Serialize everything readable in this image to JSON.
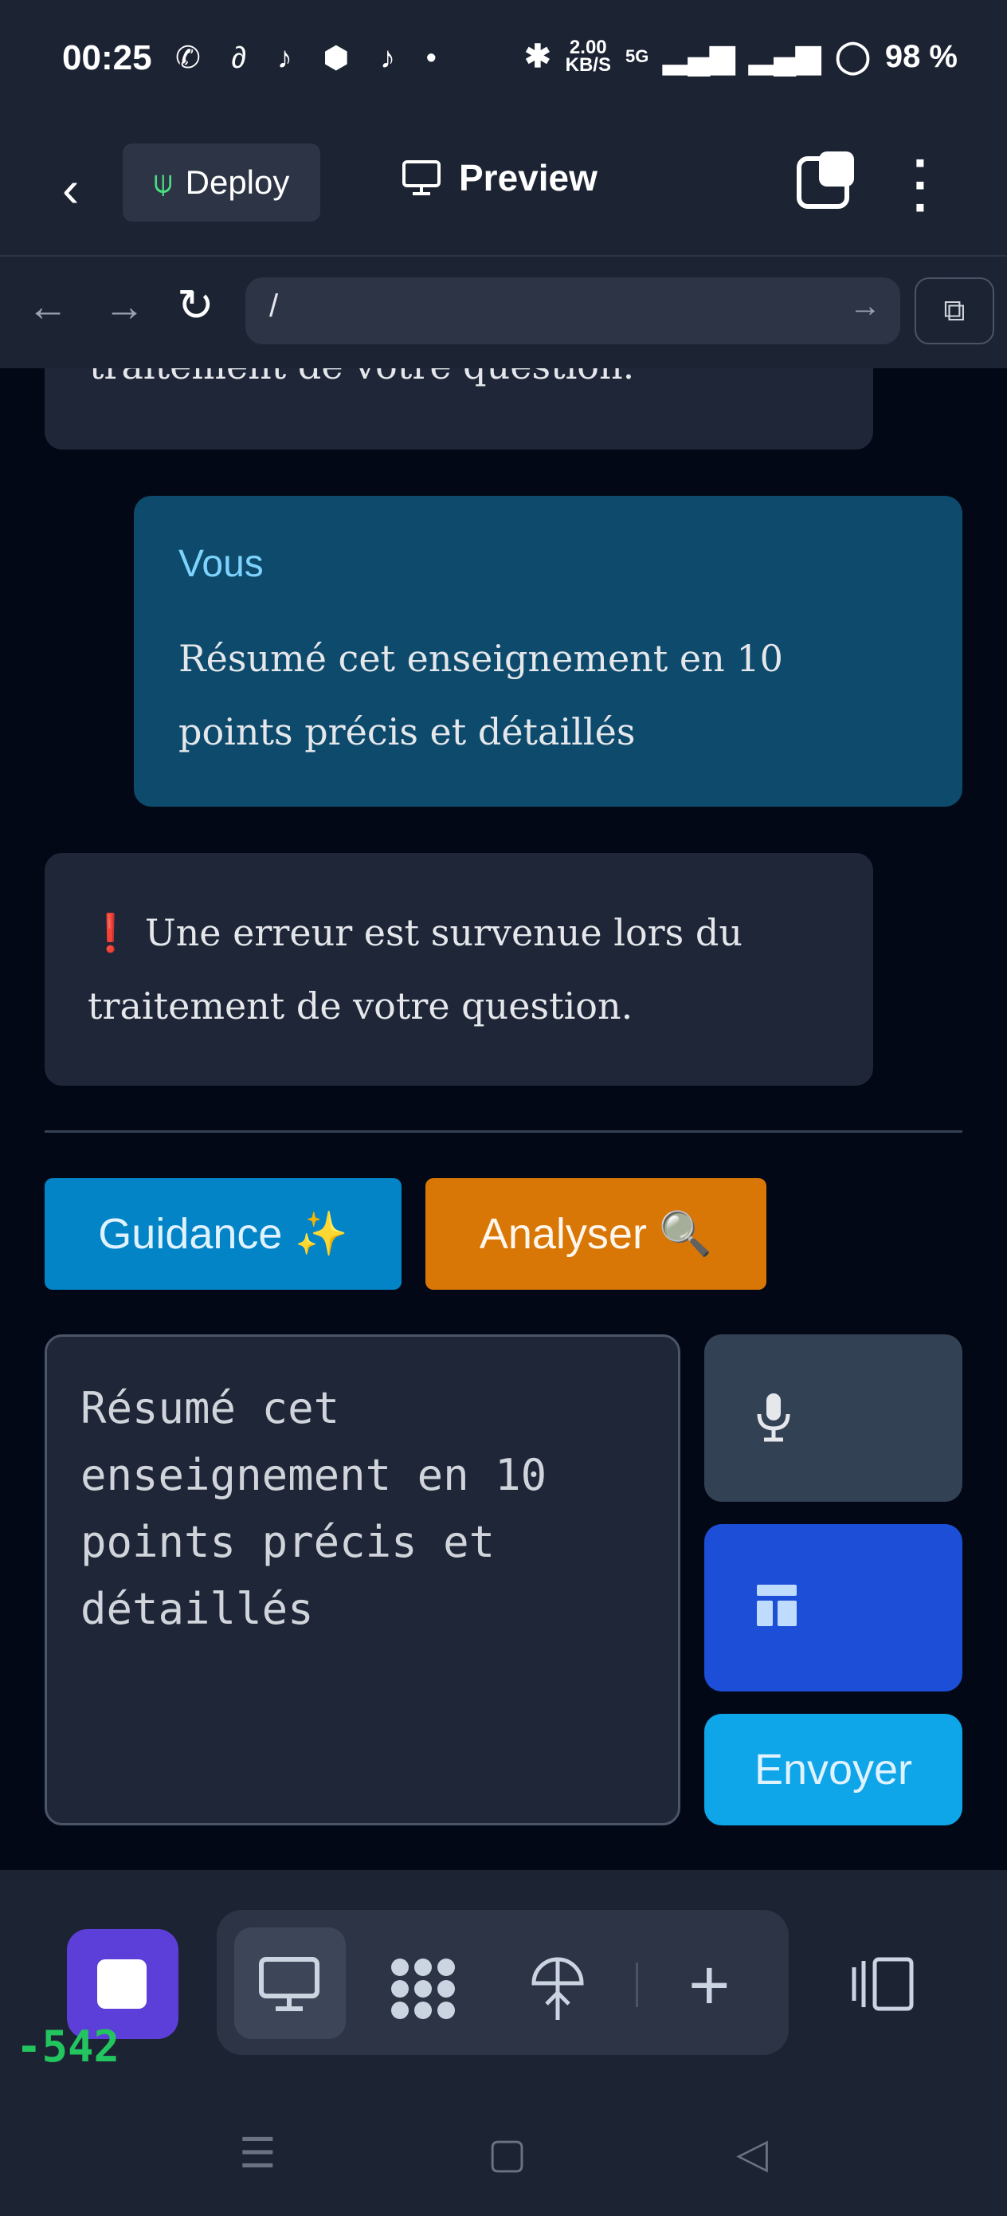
{
  "status_bar": {
    "time": "00:25",
    "left_icons": "✆ ∂ ♪ ⬢ ♪ •",
    "speed_value": "2.00",
    "speed_unit": "KB/S",
    "network": "5G",
    "battery": "98 %"
  },
  "app_bar": {
    "deploy_label": "Deploy",
    "preview_label": "Preview"
  },
  "url_bar": {
    "url": "/"
  },
  "chat": {
    "top_fragment": "traitement de votre question.",
    "user_name": "Vous",
    "user_message": "Résumé cet enseignement en 10 points précis et détaillés",
    "error_icon": "❗",
    "error_message": "Une erreur est survenue lors du traitement de votre question."
  },
  "actions": {
    "guidance_label": "Guidance ✨",
    "analyze_label": "Analyser 🔍"
  },
  "composer": {
    "input_value": "Résumé cet enseignement en 10 points précis et détaillés",
    "send_label": "Envoyer"
  },
  "toolbar": {
    "counter": "-542"
  },
  "colors": {
    "user_bubble": "#0d4a6c",
    "guidance": "#0284c7",
    "analyze": "#d97706",
    "template_button": "#1d4ed8",
    "send": "#0ea5e9",
    "stop": "#5b3fd8"
  }
}
